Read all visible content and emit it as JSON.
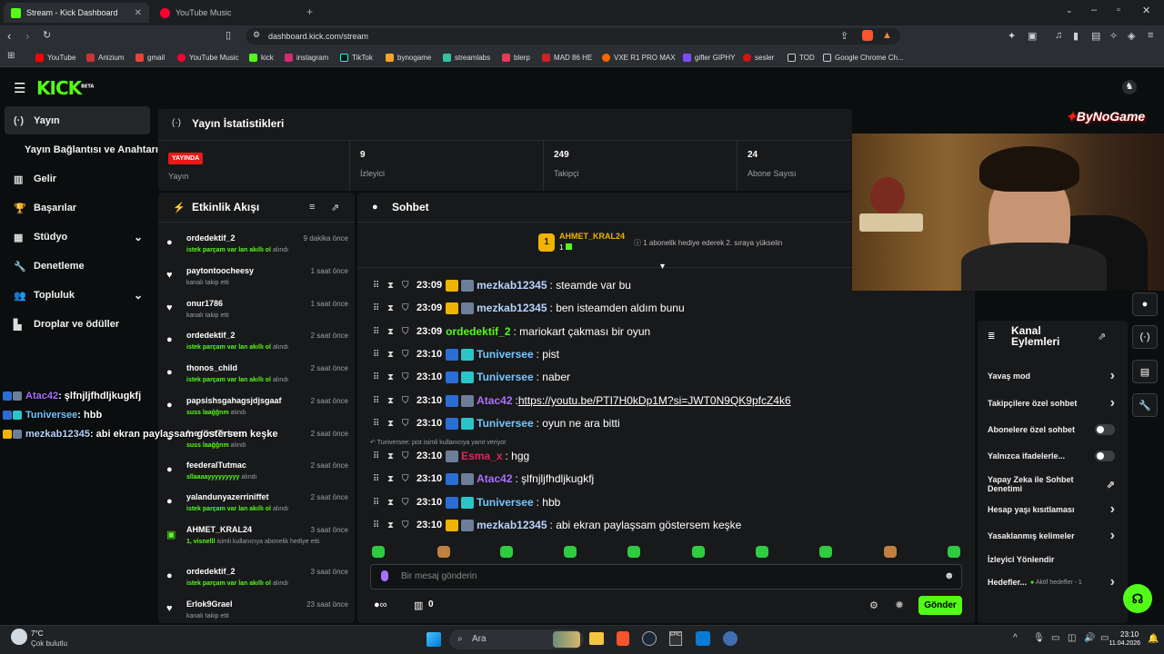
{
  "browser": {
    "tabs": [
      {
        "title": "Stream - Kick Dashboard",
        "close": "✕"
      },
      {
        "title": "YouTube Music"
      }
    ],
    "new_tab": "+",
    "url": "dashboard.kick.com/stream",
    "bookmarks": [
      "YouTube",
      "Anizium",
      "gmail",
      "YouTube Music",
      "kick",
      "instagram",
      "TikTok",
      "bynogame",
      "streamlabs",
      "blerp",
      "MAD 86 HE",
      "VXE R1 PRO MAX",
      "gifler GIPHY",
      "sesler",
      "TOD",
      "Google Chrome Ch..."
    ]
  },
  "kick": {
    "logo": "KICK",
    "logo_sup": "BETA",
    "sidebar": [
      {
        "label": "Yayın",
        "icon": "(·)"
      },
      {
        "label": "Yayın Bağlantısı ve Anahtarı",
        "icon": ""
      },
      {
        "label": "Gelir",
        "icon": "▥"
      },
      {
        "label": "Başarılar",
        "icon": "🏆"
      },
      {
        "label": "Stüdyo",
        "icon": "▦",
        "chev": "⌄"
      },
      {
        "label": "Denetleme",
        "icon": "🔧"
      },
      {
        "label": "Topluluk",
        "icon": "👥",
        "chev": "⌄"
      },
      {
        "label": "Droplar ve ödüller",
        "icon": "▙"
      }
    ],
    "overlay_chat": [
      {
        "user": "Atac42",
        "text": ": şlfnjljfhdljkugkfj",
        "color": "#a970ff"
      },
      {
        "user": "Tuniversee",
        "text": ": hbb",
        "color": "#74c7ff"
      },
      {
        "user": "mezkab12345",
        "text": " : abi ekran paylaşsam göstersem keşke",
        "color": "#b7d3ff"
      }
    ],
    "stats": {
      "title": "Yayın İstatistikleri",
      "live_badge": "YAYINDA",
      "live_label": "Yayın",
      "viewers": "9",
      "viewers_label": "İzleyici",
      "followers": "249",
      "followers_label": "Takipçi",
      "subs": "24",
      "subs_label": "Abone Sayısı"
    },
    "activity": {
      "title": "Etkinlik Akışı",
      "items": [
        {
          "user": "ordedektif_2",
          "time": "9 dakika önce",
          "desc_hl": "istek parçam var lan akıllı ol",
          "desc": "alındı",
          "icon": "●"
        },
        {
          "user": "paytontoocheesy",
          "time": "1 saat önce",
          "desc_hl": "",
          "desc": "kanalı takip etti",
          "icon": "♥"
        },
        {
          "user": "onur1786",
          "time": "1 saat önce",
          "desc_hl": "",
          "desc": "kanalı takip etti",
          "icon": "♥"
        },
        {
          "user": "ordedektif_2",
          "time": "2 saat önce",
          "desc_hl": "istek parçam var lan akıllı ol",
          "desc": "alındı",
          "icon": "●"
        },
        {
          "user": "thonos_child",
          "time": "2 saat önce",
          "desc_hl": "istek parçam var lan akıllı ol",
          "desc": "alındı",
          "icon": "●"
        },
        {
          "user": "papsishsgahagsjdjsgaaf",
          "time": "2 saat önce",
          "desc_hl": "suss laağğnm",
          "desc": "alındı",
          "icon": "●"
        },
        {
          "user": "feederalTutmac",
          "time": "2 saat önce",
          "desc_hl": "suss laağğnm",
          "desc": "alındı",
          "icon": "●"
        },
        {
          "user": "feederalTutmac",
          "time": "2 saat önce",
          "desc_hl": "sllaaaayyyyyyyyy",
          "desc": "alındı",
          "icon": "●"
        },
        {
          "user": "yalandunyazerriniffet",
          "time": "2 saat önce",
          "desc_hl": "istek parçam var lan akıllı ol",
          "desc": "alındı",
          "icon": "●"
        },
        {
          "user": "AHMET_KRAL24",
          "time": "3 saat önce",
          "desc_hl": "1, visnelll",
          "desc": "isimli kullanıcıya abonelik hediye etti.",
          "icon": "▣"
        },
        {
          "user": "ordedektif_2",
          "time": "3 saat önce",
          "desc_hl": "istek parçam var lan akıllı ol",
          "desc": "alındı",
          "icon": "●"
        },
        {
          "user": "Erlok9Grael",
          "time": "23 saat önce",
          "desc_hl": "",
          "desc": "kanalı takip etti",
          "icon": "♥"
        }
      ]
    },
    "chat": {
      "title": "Sohbet",
      "pinned_user": "AHMET_KRAL24",
      "pinned_count": "1",
      "pinned_text": "1 abonelik hediye ederek 2. sıraya yükselin",
      "reply_note": "Tuniversee: pist isimli kullanıcıya yanıt veriyor",
      "messages": [
        {
          "time": "23:09",
          "user": "mezkab12345",
          "text": ": steamde var bu",
          "color": "#b7d3ff",
          "link": false
        },
        {
          "time": "23:09",
          "user": "mezkab12345",
          "text": ": ben isteamden aldım bunu",
          "color": "#b7d3ff",
          "link": false
        },
        {
          "time": "23:09",
          "user": "ordedektif_2",
          "text": ": mariokart çakması bir oyun",
          "color": "#53fc18",
          "link": false
        },
        {
          "time": "23:10",
          "user": "Tuniversee",
          "text": ": pist",
          "color": "#74c7ff",
          "link": false
        },
        {
          "time": "23:10",
          "user": "Tuniversee",
          "text": ": naber",
          "color": "#74c7ff",
          "link": false
        },
        {
          "time": "23:10",
          "user": "Atac42",
          "text": "https://youtu.be/PTI7H0kDp1M?si=JWT0N9QK9pfcZ4k6",
          "color": "#a970ff",
          "link": true
        },
        {
          "time": "23:10",
          "user": "Tuniversee",
          "text": ": oyun ne ara bitti",
          "color": "#74c7ff",
          "link": false
        },
        {
          "time": "23:10",
          "user": "Esma_x",
          "text": ": hgg",
          "color": "#e0245e",
          "link": false
        },
        {
          "time": "23:10",
          "user": "Atac42",
          "text": ": şlfnjljfhdljkugkfj",
          "color": "#a970ff",
          "link": false
        },
        {
          "time": "23:10",
          "user": "Tuniversee",
          "text": ": hbb",
          "color": "#74c7ff",
          "link": false
        },
        {
          "time": "23:10",
          "user": "mezkab12345",
          "text": ": abi ekran paylaşsam göstersem keşke",
          "color": "#b7d3ff",
          "link": false
        }
      ],
      "placeholder": "Bir mesaj gönderin",
      "points": "0",
      "send": "Gönder"
    },
    "kanal": {
      "title": "Kanal Eylemleri",
      "rows": [
        {
          "label": "Yavaş mod",
          "type": "chev"
        },
        {
          "label": "Takipçilere özel sohbet",
          "type": "chev"
        },
        {
          "label": "Abonelere özel sohbet",
          "type": "toggle"
        },
        {
          "label": "Yalnızca ifadelerle...",
          "type": "toggle"
        },
        {
          "label": "Yapay Zeka ile Sohbet Denetimi",
          "type": "ext"
        },
        {
          "label": "Hesap yaşı kısıtlaması",
          "type": "chev"
        },
        {
          "label": "Yasaklanmış kelimeler",
          "type": "chev"
        },
        {
          "label": "İzleyici Yönlendir",
          "type": "none"
        },
        {
          "label": "Hedefler...",
          "type": "chev",
          "extra": "Aktif hedefler - 1"
        }
      ]
    },
    "cam_logo": "ByNoGame"
  },
  "taskbar": {
    "weather_temp": "7°C",
    "weather_desc": "Çok bulutlu",
    "search": "Ara",
    "time": "23:10",
    "date": "11.04.2026"
  }
}
